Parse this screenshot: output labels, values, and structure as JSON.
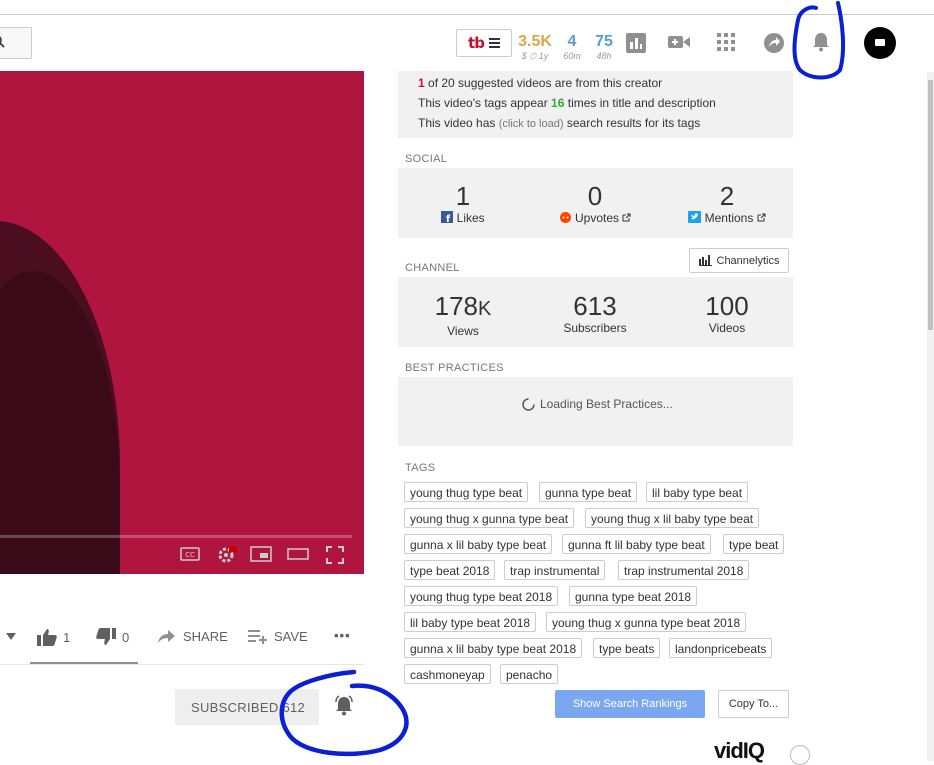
{
  "header": {
    "tubebuddy_logo": "tb",
    "stats": [
      {
        "value": "3.5K",
        "sub": "$ ⏱ 1y",
        "color": "#d9a84a"
      },
      {
        "value": "4",
        "sub": "60m",
        "color": "#5b9bd5"
      },
      {
        "value": "75",
        "sub": "48h",
        "color": "#5b9bd5"
      }
    ],
    "icons": [
      "search-icon",
      "bar-chart-icon",
      "video-camera-icon",
      "apps-grid-icon",
      "share-icon",
      "bell-icon",
      "avatar"
    ]
  },
  "suggested": {
    "line1_count": "1",
    "line1_rest": "of 20 suggested videos are from this creator",
    "line2_pre": "This video's tags appear",
    "line2_count": "16",
    "line2_post": "times in title and description",
    "line3_pre": "This video has",
    "line3_link": "(click to load)",
    "line3_post": "search results for its tags"
  },
  "social": {
    "title": "SOCIAL",
    "items": [
      {
        "value": "1",
        "label": "Likes"
      },
      {
        "value": "0",
        "label": "Upvotes"
      },
      {
        "value": "2",
        "label": "Mentions"
      }
    ]
  },
  "channel": {
    "title": "CHANNEL",
    "button": "Channelytics",
    "items": [
      {
        "value": "178",
        "suffix": "K",
        "label": "Views"
      },
      {
        "value": "613",
        "suffix": "",
        "label": "Subscribers"
      },
      {
        "value": "100",
        "suffix": "",
        "label": "Videos"
      }
    ]
  },
  "best_practices": {
    "title": "BEST PRACTICES",
    "loading": "Loading Best Practices..."
  },
  "tags": {
    "title": "TAGS",
    "items": [
      "young thug type beat",
      "gunna type beat",
      "lil baby type beat",
      "young thug x gunna type beat",
      "young thug x lil baby type beat",
      "gunna x lil baby type beat",
      "gunna ft lil baby type beat",
      "type beat",
      "type beat 2018",
      "trap instrumental",
      "trap instrumental 2018",
      "young thug type beat 2018",
      "gunna type beat 2018",
      "lil baby type beat 2018",
      "young thug x gunna type beat 2018",
      "gunna x lil baby type beat 2018",
      "type beats",
      "landonpricebeats",
      "cashmoneyap",
      "penacho"
    ]
  },
  "buttons": {
    "show_rankings": "Show Search Rankings",
    "copy_to": "Copy To..."
  },
  "video_actions": {
    "likes": "1",
    "dislikes": "0",
    "share": "SHARE",
    "save": "SAVE",
    "more": "•••"
  },
  "subscribe": {
    "label": "SUBSCRIBED",
    "count": "612"
  },
  "footer": {
    "brand": "vidIQ"
  },
  "colors": {
    "accent_red": "#c8102e",
    "video_bg": "#b01540",
    "annotation_blue": "#0a1fd6",
    "positive_green": "#2eaa2e"
  }
}
